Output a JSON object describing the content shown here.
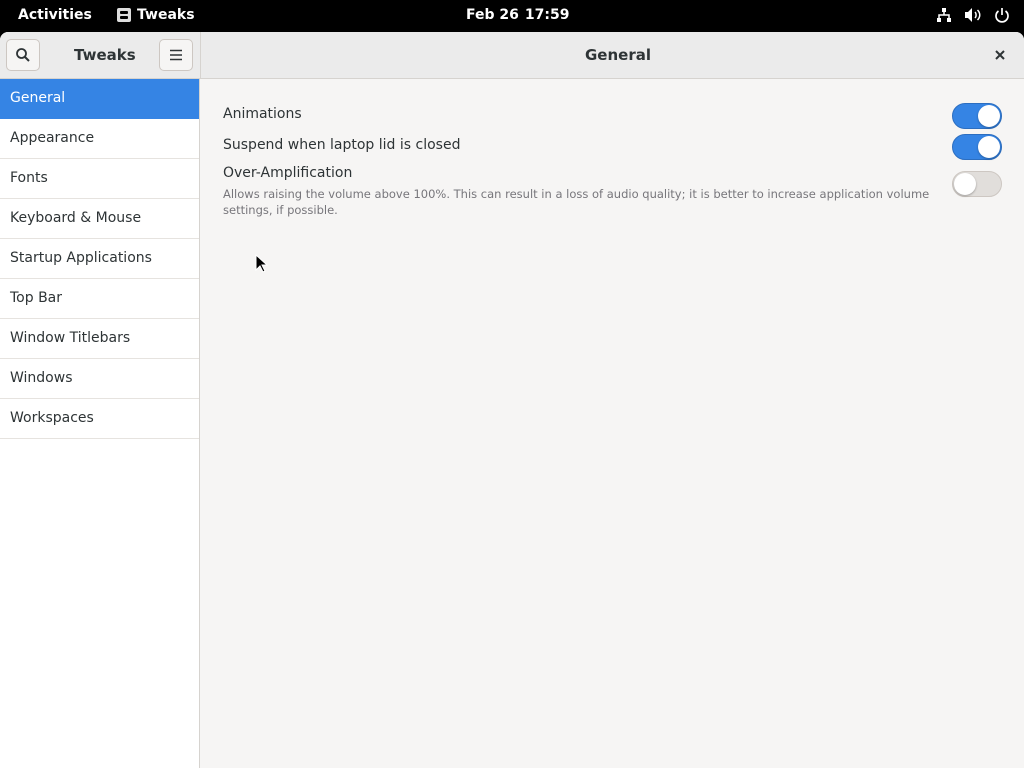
{
  "topbar": {
    "activities": "Activities",
    "app_name": "Tweaks",
    "date": "Feb 26",
    "time": "17:59",
    "icons": [
      "network-icon",
      "volume-icon",
      "power-icon"
    ]
  },
  "headerbar": {
    "sidebar_title": "Tweaks",
    "title": "General"
  },
  "sidebar": {
    "items": [
      {
        "label": "General",
        "selected": true
      },
      {
        "label": "Appearance"
      },
      {
        "label": "Fonts"
      },
      {
        "label": "Keyboard & Mouse"
      },
      {
        "label": "Startup Applications"
      },
      {
        "label": "Top Bar"
      },
      {
        "label": "Window Titlebars"
      },
      {
        "label": "Windows"
      },
      {
        "label": "Workspaces"
      }
    ]
  },
  "settings": [
    {
      "label": "Animations",
      "enabled": true
    },
    {
      "label": "Suspend when laptop lid is closed",
      "enabled": true
    },
    {
      "label": "Over-Amplification",
      "description": "Allows raising the volume above 100%. This can result in a loss of audio quality; it is better to increase application volume settings, if possible.",
      "enabled": false
    }
  ],
  "colors": {
    "accent": "#3584e4",
    "topbar": "#000000",
    "window_bg": "#f6f5f4"
  }
}
